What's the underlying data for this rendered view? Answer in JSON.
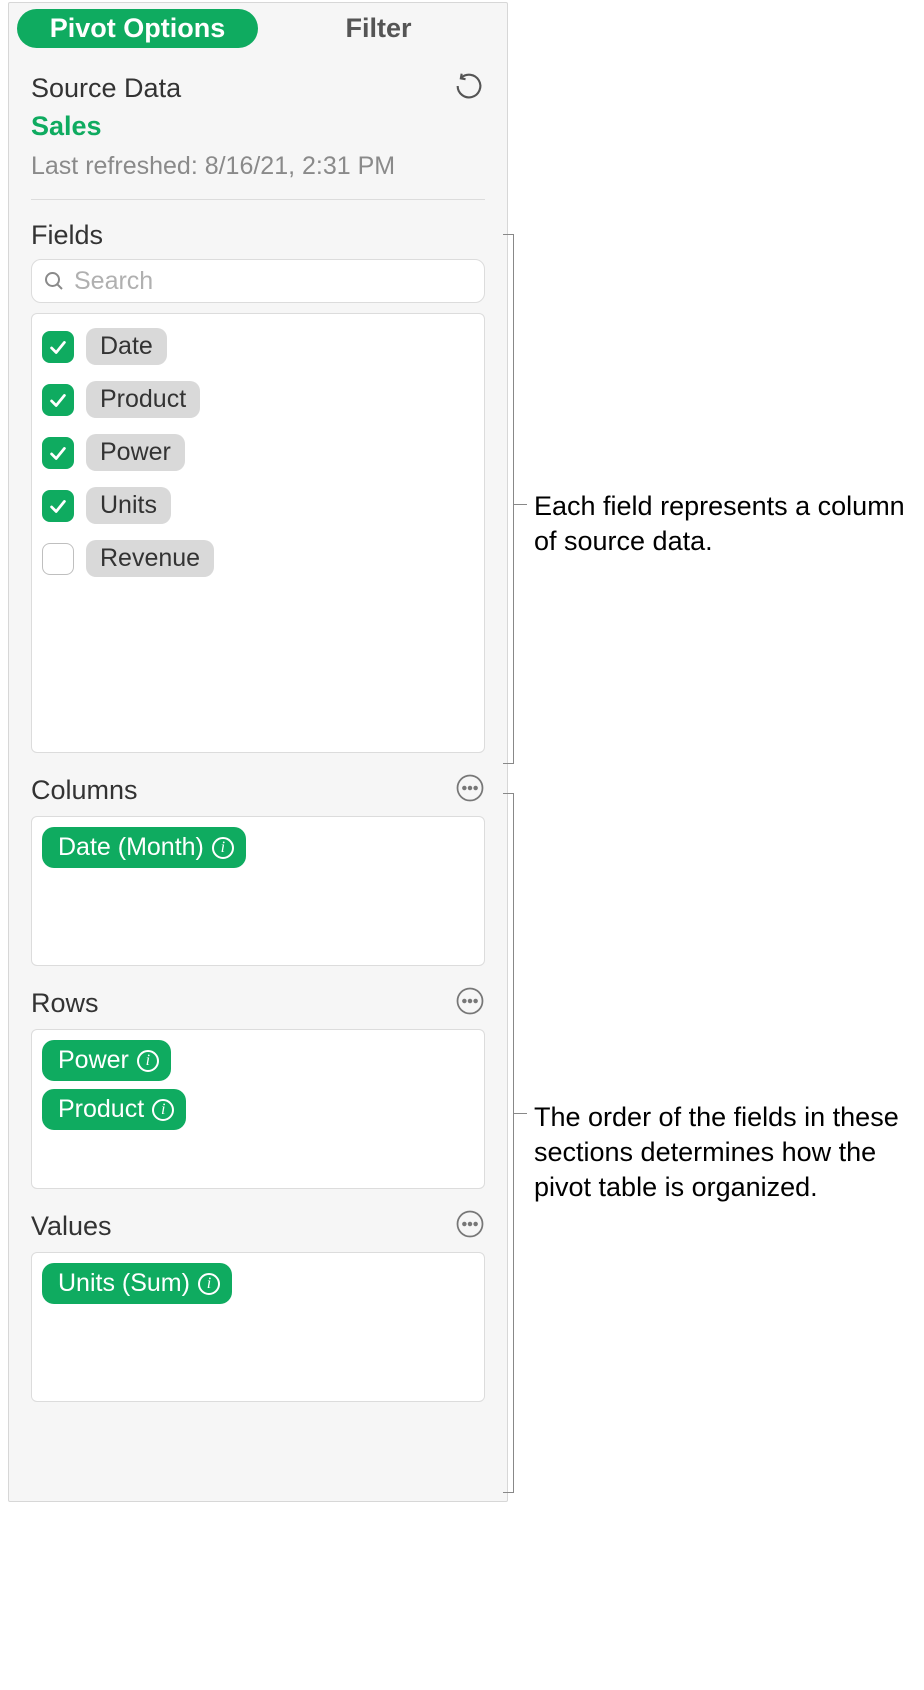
{
  "tabs": {
    "pivot_options": "Pivot Options",
    "filter": "Filter"
  },
  "source": {
    "label": "Source Data",
    "name": "Sales",
    "last_refreshed": "Last refreshed: 8/16/21, 2:31 PM"
  },
  "fields": {
    "label": "Fields",
    "search_placeholder": "Search",
    "items": [
      {
        "label": "Date",
        "checked": true
      },
      {
        "label": "Product",
        "checked": true
      },
      {
        "label": "Power",
        "checked": true
      },
      {
        "label": "Units",
        "checked": true
      },
      {
        "label": "Revenue",
        "checked": false
      }
    ]
  },
  "columns": {
    "label": "Columns",
    "items": [
      {
        "label": "Date (Month)"
      }
    ]
  },
  "rows": {
    "label": "Rows",
    "items": [
      {
        "label": "Power"
      },
      {
        "label": "Product"
      }
    ]
  },
  "values": {
    "label": "Values",
    "items": [
      {
        "label": "Units (Sum)"
      }
    ]
  },
  "callouts": {
    "fields_note": "Each field represents a column of source data.",
    "sections_note": "The order of the fields in these sections determines how the pivot table is organized."
  }
}
